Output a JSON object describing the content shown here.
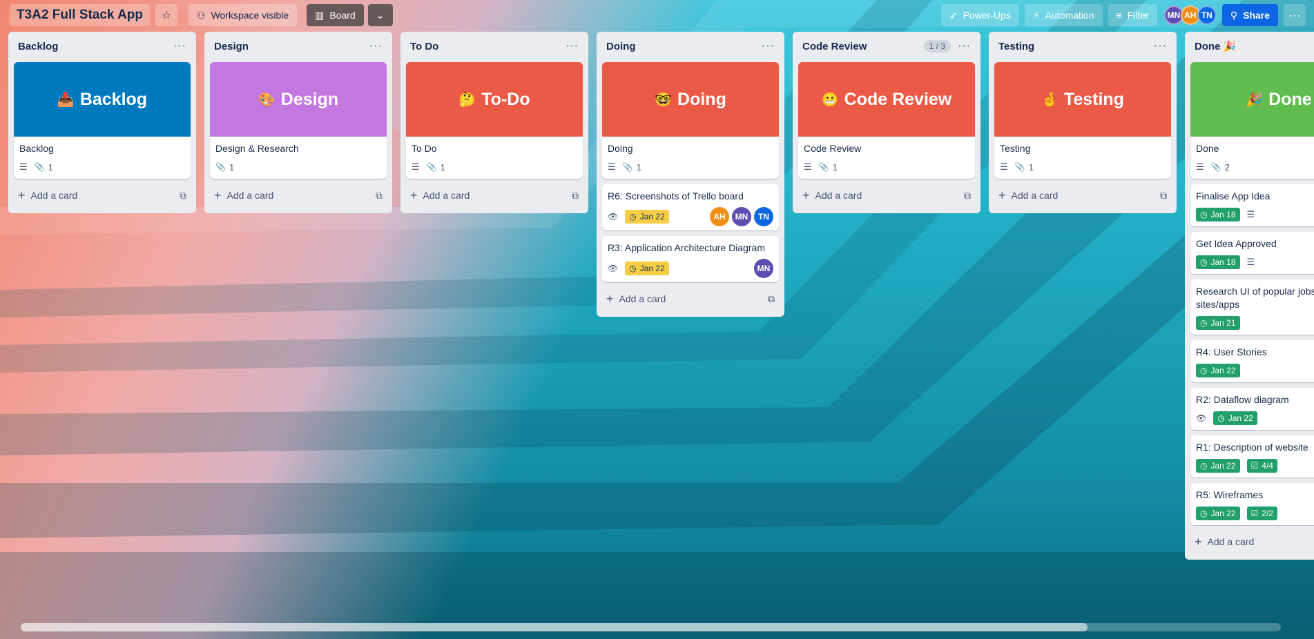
{
  "topbar": {
    "board_title": "T3A2 Full Stack App",
    "workspace_label": "Workspace visible",
    "view_label": "Board",
    "powerups_label": "Power-Ups",
    "automation_label": "Automation",
    "filter_label": "Filter",
    "share_label": "Share",
    "members": [
      {
        "initials": "MN",
        "color": "#5e4db2"
      },
      {
        "initials": "AH",
        "color": "#f18d13"
      },
      {
        "initials": "TN",
        "color": "#0c66e4"
      }
    ]
  },
  "lists": [
    {
      "title": "Backlog",
      "cover": {
        "emoji": "📥",
        "text": "Backlog",
        "color": "#0079bf"
      },
      "card_title": "Backlog",
      "attachments": "1",
      "has_description": true,
      "add_label": "Add a card"
    },
    {
      "title": "Design",
      "cover": {
        "emoji": "🎨",
        "text": "Design",
        "color": "#c377e0"
      },
      "card_title": "Design & Research",
      "attachments": "1",
      "has_description": false,
      "add_label": "Add a card"
    },
    {
      "title": "To Do",
      "cover": {
        "emoji": "🤔",
        "text": "To-Do",
        "color": "#eb5a46"
      },
      "card_title": "To Do",
      "attachments": "1",
      "has_description": true,
      "add_label": "Add a card"
    },
    {
      "title": "Doing",
      "cover": {
        "emoji": "🤓",
        "text": "Doing",
        "color": "#eb5a46"
      },
      "card_title": "Doing",
      "attachments": "1",
      "has_description": true,
      "add_label": "Add a card",
      "extra_cards": [
        {
          "title": "R6: Screenshots of Trello board",
          "date": "Jan 22",
          "members": [
            "AH",
            "MN",
            "TN"
          ]
        },
        {
          "title": "R3: Application Architecture Diagram",
          "date": "Jan 22",
          "members": [
            "MN"
          ]
        }
      ]
    },
    {
      "title": "Code Review",
      "count": "1 / 3",
      "cover": {
        "emoji": "😬",
        "text": "Code Review",
        "color": "#eb5a46"
      },
      "card_title": "Code Review",
      "attachments": "1",
      "has_description": true,
      "add_label": "Add a card"
    },
    {
      "title": "Testing",
      "cover": {
        "emoji": "🤞",
        "text": "Testing",
        "color": "#eb5a46"
      },
      "card_title": "Testing",
      "attachments": "1",
      "has_description": true,
      "add_label": "Add a card"
    },
    {
      "title": "Done 🎉",
      "cover": {
        "emoji": "🎉",
        "text": "Done",
        "color": "#61bd4f"
      },
      "card_title": "Done",
      "attachments": "2",
      "has_description": true,
      "add_label": "Add a card",
      "done_cards": [
        {
          "title": "Finalise App Idea",
          "date": "Jan 18",
          "desc": true
        },
        {
          "title": "Get Idea Approved",
          "date": "Jan 18",
          "desc": true
        },
        {
          "title": "Research UI of popular jobsearch sites/apps",
          "date": "Jan 21"
        },
        {
          "title": "R4: User Stories",
          "date": "Jan 22"
        },
        {
          "title": "R2: Dataflow diagram",
          "date": "Jan 22",
          "watch": true
        },
        {
          "title": "R1: Description of website",
          "date": "Jan 22",
          "checklist": "4/4"
        },
        {
          "title": "R5: Wireframes",
          "date": "Jan 22",
          "checklist": "2/2"
        }
      ]
    }
  ],
  "member_colors": {
    "AH": "#f18d13",
    "MN": "#5e4db2",
    "TN": "#0c66e4"
  },
  "scrollbar": {
    "position_fraction": 0.85
  }
}
